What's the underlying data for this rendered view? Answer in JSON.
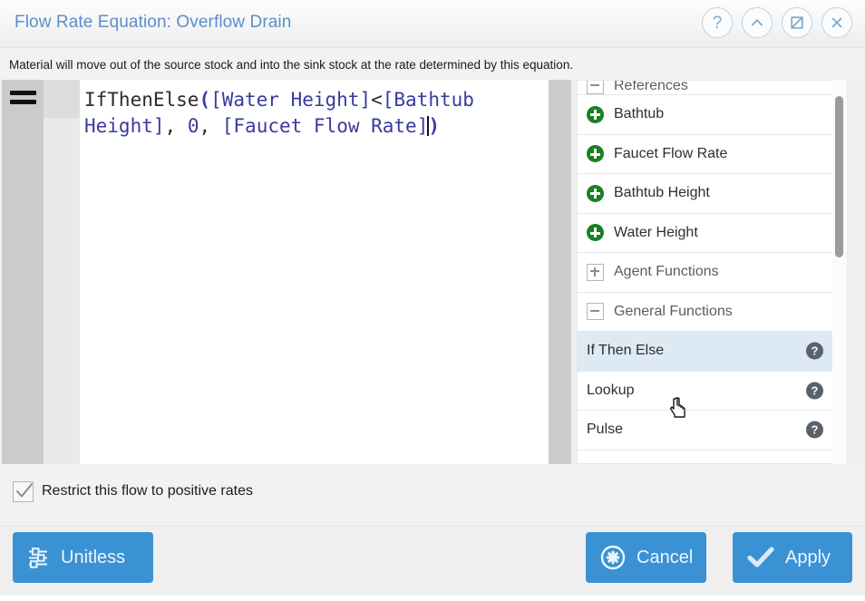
{
  "window": {
    "title": "Flow Rate Equation: Overflow Drain",
    "subtitle": "Material will move out of the source stock and into the sink stock at the rate determined by this equation.",
    "controls": [
      {
        "name": "help-button",
        "glyph": "?"
      },
      {
        "name": "collapse-button",
        "glyph": "^"
      },
      {
        "name": "restore-button",
        "glyph": ""
      },
      {
        "name": "close-button",
        "glyph": "X"
      }
    ]
  },
  "editor": {
    "gutter_icon": "equals-icon",
    "equation_raw": "IfThenElse([Water Height]<[Bathtub Height], 0, [Faucet Flow Rate])",
    "tokens": [
      {
        "t": "IfThenElse",
        "k": "fn"
      },
      {
        "t": "(",
        "k": "paren"
      },
      {
        "t": "[Water Height]",
        "k": "var"
      },
      {
        "t": "<",
        "k": "op"
      },
      {
        "t": "[Bathtub Height]",
        "k": "var"
      },
      {
        "t": ", ",
        "k": "comma"
      },
      {
        "t": "0",
        "k": "num"
      },
      {
        "t": ", ",
        "k": "comma"
      },
      {
        "t": "[Faucet Flow Rate]",
        "k": "var"
      },
      {
        "t": ")",
        "k": "paren"
      }
    ]
  },
  "references": {
    "rows": [
      {
        "label": "References",
        "type": "group-partial",
        "icon": "tree-collapse-icon",
        "expanded": true,
        "help": false,
        "selected": false
      },
      {
        "label": "Bathtub",
        "type": "variable",
        "icon": "green-plus-icon",
        "help": false,
        "selected": false
      },
      {
        "label": "Faucet Flow Rate",
        "type": "variable",
        "icon": "green-plus-icon",
        "help": false,
        "selected": false
      },
      {
        "label": "Bathtub Height",
        "type": "variable",
        "icon": "green-plus-icon",
        "help": false,
        "selected": false
      },
      {
        "label": "Water Height",
        "type": "variable",
        "icon": "green-plus-icon",
        "help": false,
        "selected": false
      },
      {
        "label": "Agent Functions",
        "type": "group",
        "icon": "tree-expand-icon",
        "expanded": false,
        "help": false,
        "selected": false
      },
      {
        "label": "General Functions",
        "type": "group",
        "icon": "tree-collapse-icon",
        "expanded": true,
        "help": false,
        "selected": false
      },
      {
        "label": "If Then Else",
        "type": "function",
        "icon": "none",
        "help": true,
        "selected": true
      },
      {
        "label": "Lookup",
        "type": "function",
        "icon": "none",
        "help": true,
        "selected": false
      },
      {
        "label": "Pulse",
        "type": "function",
        "icon": "none",
        "help": true,
        "selected": false
      }
    ],
    "help_glyph": "?"
  },
  "options": {
    "restrict_label": "Restrict this flow to positive rates",
    "restrict_checked": true
  },
  "footer": {
    "unitless_label": "Unitless",
    "cancel_label": "Cancel",
    "apply_label": "Apply"
  },
  "colors": {
    "accent_blue": "#3a92d4",
    "title_blue": "#5b8fc9",
    "selection_blue": "#dde9f3",
    "variable_green": "#1a8022",
    "token_var": "#3a3a9e",
    "token_fn": "#2b2b2b"
  }
}
